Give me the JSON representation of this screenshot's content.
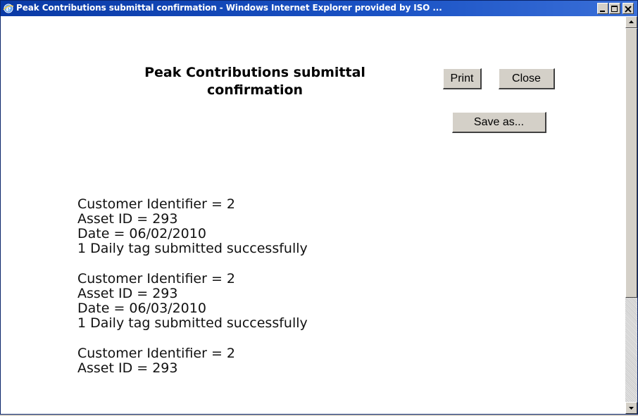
{
  "window": {
    "title": "Peak Contributions submittal confirmation - Windows Internet Explorer provided by ISO ...",
    "colors": {
      "titlebar": "#0a3aa6",
      "button_face": "#d4d0c8"
    }
  },
  "page": {
    "heading": "Peak Contributions submittal confirmation",
    "buttons": {
      "print": "Print",
      "close": "Close",
      "save_as": "Save as..."
    }
  },
  "records": [
    {
      "customer": "Customer Identifier = 2",
      "asset": "Asset ID = 293",
      "date": "Date = 06/02/2010",
      "status": "1 Daily tag submitted successfully"
    },
    {
      "customer": "Customer Identifier = 2",
      "asset": "Asset ID = 293",
      "date": "Date = 06/03/2010",
      "status": "1 Daily tag submitted successfully"
    },
    {
      "customer": "Customer Identifier = 2",
      "asset": "Asset ID = 293"
    }
  ]
}
